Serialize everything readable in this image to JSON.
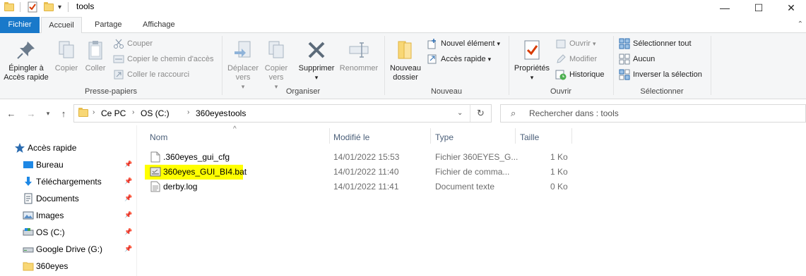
{
  "window": {
    "title": "tools",
    "minimize_glyph": "—",
    "maximize_glyph": "☐",
    "close_glyph": "✕"
  },
  "ribbon_tabs": [
    "Fichier",
    "Accueil",
    "Partage",
    "Affichage"
  ],
  "ribbon": {
    "pin_label": "Épingler à Accès rapide",
    "copy_label": "Copier",
    "paste_label": "Coller",
    "cut_label": "Couper",
    "copy_path_label": "Copier le chemin d'accès",
    "paste_shortcut_label": "Coller le raccourci",
    "clipboard_group": "Presse-papiers",
    "move_to_label": "Déplacer vers",
    "copy_to_label": "Copier vers",
    "delete_label": "Supprimer",
    "rename_label": "Renommer",
    "organize_group": "Organiser",
    "new_folder_label": "Nouveau dossier",
    "new_item_label": "Nouvel élément",
    "easy_access_label": "Accès rapide",
    "new_group": "Nouveau",
    "properties_label": "Propriétés",
    "open_label": "Ouvrir",
    "edit_label": "Modifier",
    "history_label": "Historique",
    "open_group": "Ouvrir",
    "select_all_label": "Sélectionner tout",
    "select_none_label": "Aucun",
    "invert_selection_label": "Inverser la sélection",
    "select_group": "Sélectionner"
  },
  "address": {
    "breadcrumb": [
      "Ce PC",
      "OS (C:)",
      "360eyes",
      "tools"
    ],
    "search_placeholder": "Rechercher dans : tools"
  },
  "nav_pane": {
    "items": [
      {
        "label": "Accès rapide",
        "icon": "star-icon",
        "pinned": false
      },
      {
        "label": "Bureau",
        "icon": "desktop-icon",
        "pinned": true
      },
      {
        "label": "Téléchargements",
        "icon": "download-icon",
        "pinned": true
      },
      {
        "label": "Documents",
        "icon": "documents-icon",
        "pinned": true
      },
      {
        "label": "Images",
        "icon": "pictures-icon",
        "pinned": true
      },
      {
        "label": "OS (C:)",
        "icon": "drive-icon",
        "pinned": true
      },
      {
        "label": "Google Drive (G:)",
        "icon": "drive-icon",
        "pinned": true
      },
      {
        "label": "360eyes",
        "icon": "folder-icon",
        "pinned": false
      }
    ]
  },
  "file_list": {
    "columns": [
      "Nom",
      "Modifié le",
      "Type",
      "Taille"
    ],
    "rows": [
      {
        "name": ".360eyes_gui_cfg",
        "modified": "14/01/2022 15:53",
        "type": "Fichier 360EYES_G...",
        "size": "1 Ko",
        "highlighted": false,
        "icon": "file-icon"
      },
      {
        "name": "360eyes_GUI_BI4.bat",
        "modified": "14/01/2022 11:40",
        "type": "Fichier de comma...",
        "size": "1 Ko",
        "highlighted": true,
        "icon": "batch-file-icon"
      },
      {
        "name": "derby.log",
        "modified": "14/01/2022 11:41",
        "type": "Document texte",
        "size": "0 Ko",
        "highlighted": false,
        "icon": "text-file-icon"
      }
    ]
  },
  "colors": {
    "file_tab": "#1979ca",
    "highlight": "#ffff00",
    "folder": "#f8d775"
  }
}
